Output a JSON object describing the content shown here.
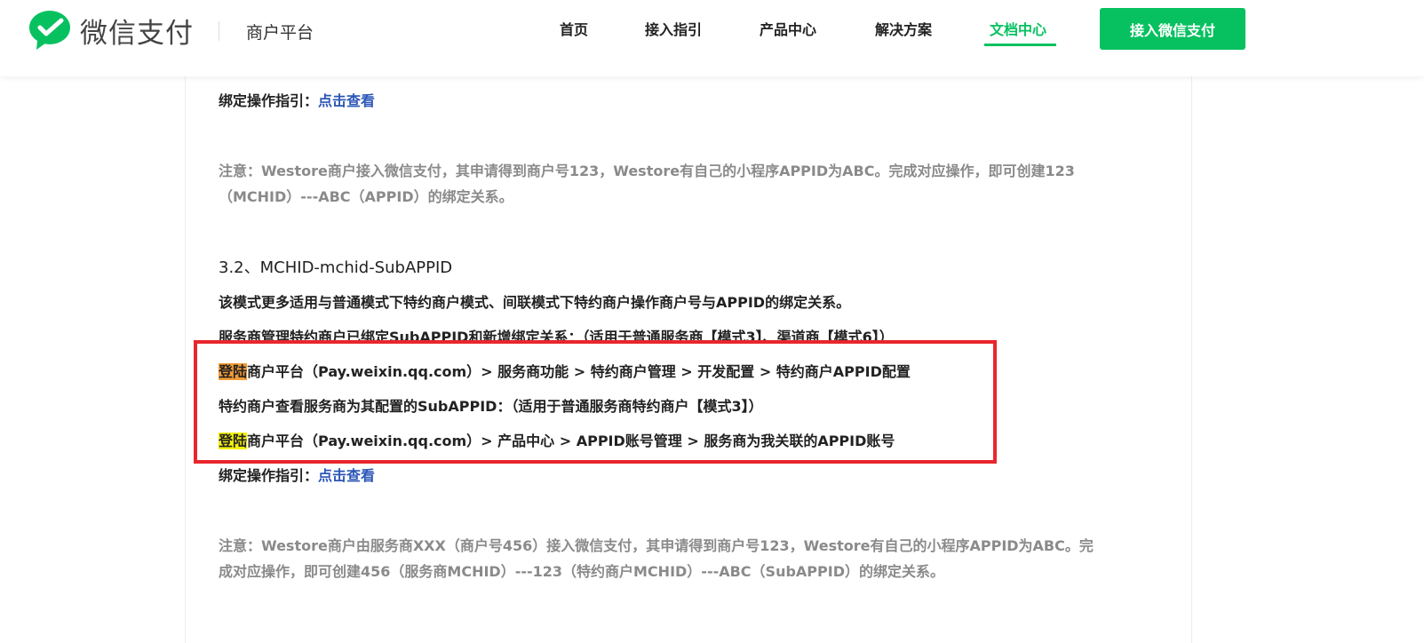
{
  "header": {
    "brand": "微信支付",
    "subbrand": "商户平台",
    "nav": [
      "首页",
      "接入指引",
      "产品中心",
      "解决方案",
      "文档中心"
    ],
    "active_nav": "文档中心",
    "cta": "接入微信支付",
    "accent_color": "#07c160"
  },
  "content": {
    "guide1": {
      "label": "绑定操作指引：",
      "link": "点击查看"
    },
    "note1_line1": "注意：Westore商户接入微信支付，其申请得到商户号123，Westore有自己的小程序APPID为ABC。完成对应操作，即可创建123",
    "note1_line2": "（MCHID）---ABC（APPID）的绑定关系。",
    "heading": "3.2、MCHID-mchid-SubAPPID",
    "para1": "该模式更多适用与普通模式下特约商户模式、间联模式下特约商户操作商户号与APPID的绑定关系。",
    "para2": "服务商管理特约商户已绑定SubAPPID和新增绑定关系：（适用于普通服务商【模式3】、渠道商【模式6】）",
    "step1": {
      "highlight": "登陆",
      "text": "商户平台（Pay.weixin.qq.com）> 服务商功能 > 特约商户管理 > 开发配置 > 特约商户APPID配置"
    },
    "step2": "特约商户查看服务商为其配置的SubAPPID：（适用于普通服务商特约商户【模式3】）",
    "step3": {
      "highlight": "登陆",
      "text": "商户平台（Pay.weixin.qq.com）> 产品中心 > APPID账号管理 > 服务商为我关联的APPID账号"
    },
    "guide2": {
      "label": "绑定操作指引：",
      "link": "点击查看"
    },
    "note2_line1": "注意：Westore商户由服务商XXX（商户号456）接入微信支付，其申请得到商户号123，Westore有自己的小程序APPID为ABC。完",
    "note2_line2": "成对应操作，即可创建456（服务商MCHID）---123（特约商户MCHID）---ABC（SubAPPID）的绑定关系。",
    "highlight_color": "#e8262c"
  }
}
